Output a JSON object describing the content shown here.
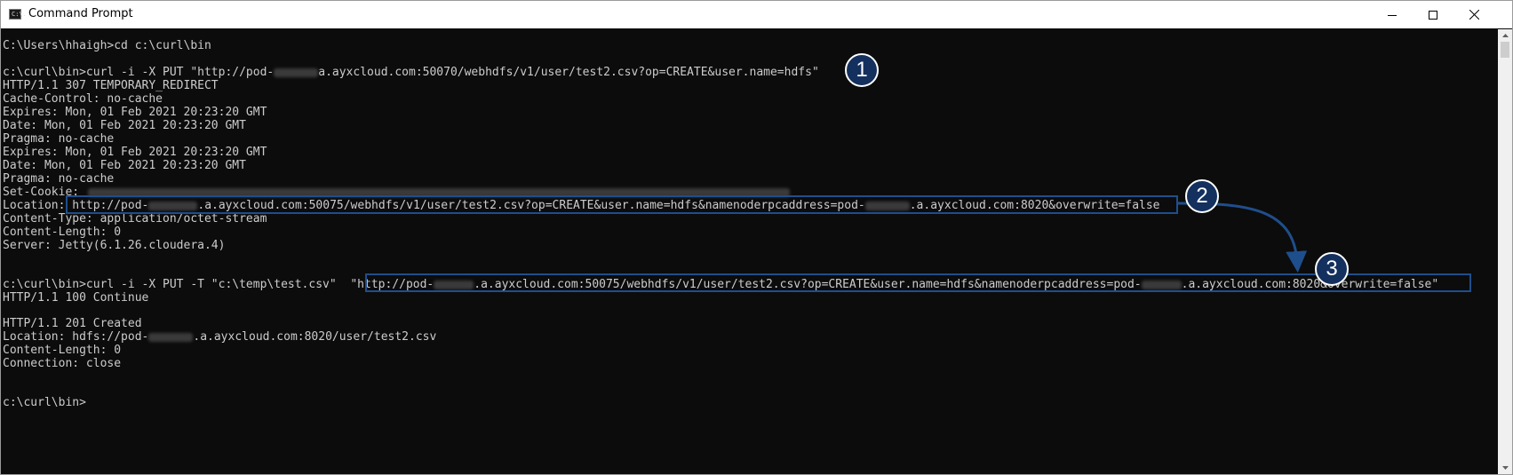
{
  "window": {
    "title": "Command Prompt",
    "icon": "cmd-icon",
    "icon_text": "C:\\."
  },
  "controls": {
    "minimize": "minimize-icon",
    "maximize": "maximize-icon",
    "close": "close-icon"
  },
  "terminal": {
    "lines": [
      "C:\\Users\\hhaigh>cd c:\\curl\\bin",
      "",
      "c:\\curl\\bin>curl -i -X PUT \"http://pod-",
      "HTTP/1.1 307 TEMPORARY_REDIRECT",
      "Cache-Control: no-cache",
      "Expires: Mon, 01 Feb 2021 20:23:20 GMT",
      "Date: Mon, 01 Feb 2021 20:23:20 GMT",
      "Pragma: no-cache",
      "Expires: Mon, 01 Feb 2021 20:23:20 GMT",
      "Date: Mon, 01 Feb 2021 20:23:20 GMT",
      "Pragma: no-cache",
      "Set-Cookie:",
      "Location: http://pod-",
      "Content-Type: application/octet-stream",
      "Content-Length: 0",
      "Server: Jetty(6.1.26.cloudera.4)",
      "",
      "",
      "c:\\curl\\bin>curl -i -X PUT -T \"c:\\temp\\test.csv\"  \"http://pod-",
      "HTTP/1.1 100 Continue",
      "",
      "HTTP/1.1 201 Created",
      "Location: hdfs://pod-",
      "Content-Length: 0",
      "Connection: close",
      "",
      "",
      "c:\\curl\\bin>"
    ],
    "line2_rest": "a.ayxcloud.com:50070/webhdfs/v1/user/test2.csv?op=CREATE&user.name=hdfs\"",
    "line12_mid": ".a.ayxcloud.com:50075/webhdfs/v1/user/test2.csv?op=CREATE&user.name=hdfs&namenoderpcaddress=pod-",
    "line12_rest": ".a.ayxcloud.com:8020&overwrite=false",
    "line18_mid": ".a.ayxcloud.com:50075/webhdfs/v1/user/test2.csv?op=CREATE&user.name=hdfs&namenoderpcaddress=pod-",
    "line18_rest": ".a.ayxcloud.com:8020&overwrite=false\"",
    "line22_rest": ".a.ayxcloud.com:8020/user/test2.csv"
  },
  "annotations": {
    "badge1": "1",
    "badge2": "2",
    "badge3": "3",
    "color": "#1f4e8c",
    "badge_color": "#14305e"
  }
}
